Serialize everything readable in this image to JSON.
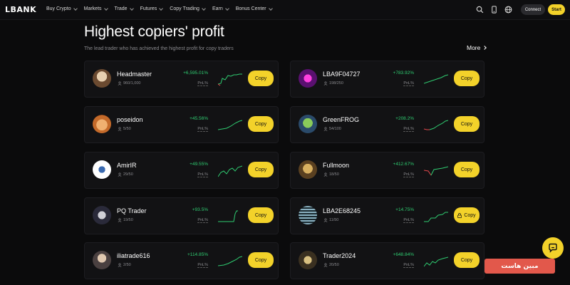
{
  "nav": {
    "logo": "LBANK",
    "menu": [
      "Buy Crypto",
      "Markets",
      "Trade",
      "Futures",
      "Copy Trading",
      "Earn",
      "Bonus Center"
    ],
    "connect_label": "Connect",
    "start_label": "Start"
  },
  "page": {
    "title": "Highest copiers' profit",
    "subtitle": "The lead trader who has achieved the highest profit for copy traders",
    "more_label": "More"
  },
  "traders_left": [
    {
      "name": "Headmaster",
      "copiers": "960/1,000",
      "profit": "+6,595.01%",
      "pnl_label": "PnL%",
      "copy_label": "Copy",
      "locked": false
    },
    {
      "name": "poseidon",
      "copiers": "5/50",
      "profit": "+45.56%",
      "pnl_label": "PnL%",
      "copy_label": "Copy",
      "locked": false
    },
    {
      "name": "AmirIR",
      "copiers": "29/50",
      "profit": "+49.55%",
      "pnl_label": "PnL%",
      "copy_label": "Copy",
      "locked": false
    },
    {
      "name": "PQ Trader",
      "copiers": "19/50",
      "profit": "+93.5%",
      "pnl_label": "PnL%",
      "copy_label": "Copy",
      "locked": false
    },
    {
      "name": "iliatrade616",
      "copiers": "2/50",
      "profit": "+114.85%",
      "pnl_label": "PnL%",
      "copy_label": "Copy",
      "locked": false
    }
  ],
  "traders_right": [
    {
      "name": "LBA9F04727",
      "copiers": "198/250",
      "profit": "+783.92%",
      "pnl_label": "PnL%",
      "copy_label": "Copy",
      "locked": false
    },
    {
      "name": "GreenFROG",
      "copiers": "54/100",
      "profit": "+208.2%",
      "pnl_label": "PnL%",
      "copy_label": "Copy",
      "locked": false
    },
    {
      "name": "Fullmoon",
      "copiers": "18/50",
      "profit": "+412.67%",
      "pnl_label": "PnL%",
      "copy_label": "Copy",
      "locked": false
    },
    {
      "name": "LBA2E68245",
      "copiers": "11/50",
      "profit": "+14.75%",
      "pnl_label": "PnL%",
      "copy_label": "Copy",
      "locked": true
    },
    {
      "name": "Trader2024",
      "copiers": "20/50",
      "profit": "+648.84%",
      "pnl_label": "PnL%",
      "copy_label": "Copy",
      "locked": false
    }
  ],
  "watermark": "مبین هاست",
  "colors": {
    "accent": "#f3d22a",
    "profit": "#2fcc71",
    "loss": "#e5484d",
    "background": "#0b0b0c",
    "card": "#121214"
  },
  "icons": [
    "search-icon",
    "mobile-icon",
    "globe-icon",
    "user-icon",
    "lock-icon",
    "chat-icon"
  ]
}
